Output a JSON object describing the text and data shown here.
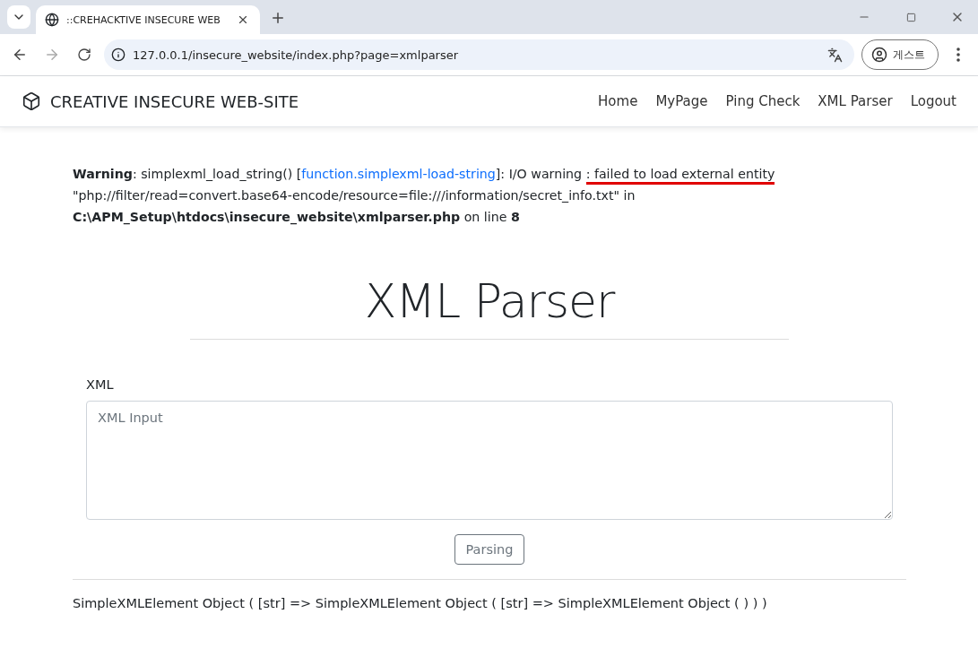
{
  "browser": {
    "tab_title": "::CREHACKTIVE INSECURE WEB",
    "address": "127.0.0.1/insecure_website/index.php?page=xmlparser",
    "profile": "게스트"
  },
  "navbar": {
    "brand": "CREATIVE INSECURE WEB-SITE",
    "links": [
      "Home",
      "MyPage",
      "Ping Check",
      "XML Parser",
      "Logout"
    ]
  },
  "warning": [
    {
      "kind": "bold",
      "text": "Warning"
    },
    {
      "kind": "text",
      "text": ": simplexml_load_string() ["
    },
    {
      "kind": "link",
      "text": "function.simplexml-load-string"
    },
    {
      "kind": "text",
      "text": "]: I/O warning "
    },
    {
      "kind": "marked",
      "text": ": failed to load external entity"
    },
    {
      "kind": "text",
      "text": " \"php://filter/read=convert.base64-encode/resource=file:///information/secret_info.txt\" in "
    },
    {
      "kind": "bold",
      "text": "C:\\APM_Setup\\htdocs\\insecure_website\\xmlparser.php"
    },
    {
      "kind": "text",
      "text": " on line "
    },
    {
      "kind": "bold",
      "text": "8"
    }
  ],
  "title": "XML Parser",
  "form": {
    "label": "XML",
    "placeholder": "XML Input",
    "button": "Parsing"
  },
  "result": "SimpleXMLElement Object ( [str] => SimpleXMLElement Object ( [str] => SimpleXMLElement Object ( ) ) )"
}
